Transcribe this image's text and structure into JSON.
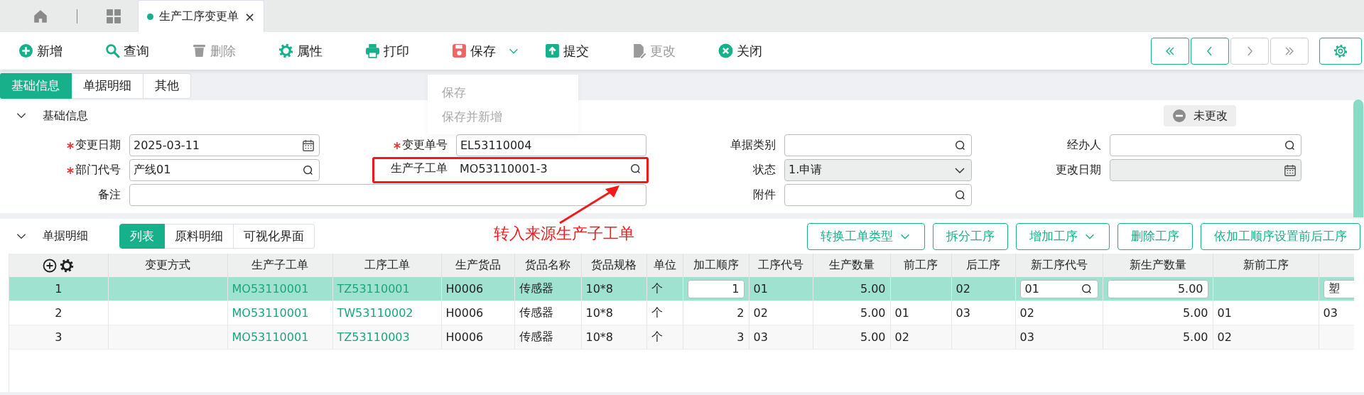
{
  "tab_bar": {
    "tabs": [
      {
        "kind": "home",
        "selected": false
      },
      {
        "kind": "apps",
        "selected": false
      },
      {
        "kind": "page",
        "label": "生产工序变更单",
        "close": "×",
        "selected": true
      }
    ]
  },
  "toolbar": {
    "items": [
      {
        "label": "新增",
        "disabled": false,
        "dropdown": false
      },
      {
        "label": "查询",
        "disabled": false,
        "dropdown": false
      },
      {
        "label": "删除",
        "disabled": true,
        "dropdown": false
      },
      {
        "label": "属性",
        "disabled": false,
        "dropdown": false
      },
      {
        "label": "打印",
        "disabled": false,
        "dropdown": false
      },
      {
        "label": "保存",
        "disabled": false,
        "dropdown": true
      },
      {
        "label": "提交",
        "disabled": false,
        "dropdown": false
      },
      {
        "label": "更改",
        "disabled": true,
        "dropdown": false
      },
      {
        "label": "关闭",
        "disabled": false,
        "dropdown": false
      }
    ],
    "save_menu": [
      {
        "label": "保存"
      },
      {
        "label": "保存并新增"
      }
    ],
    "nav": [
      {
        "disabled": false
      },
      {
        "disabled": false
      },
      {
        "disabled": true
      },
      {
        "disabled": true
      }
    ]
  },
  "page_tabs": [
    {
      "label": "基础信息",
      "selected": true
    },
    {
      "label": "单据明细",
      "selected": false
    },
    {
      "label": "其他",
      "selected": false
    }
  ],
  "basic_info": {
    "title": "基础信息",
    "expanded": true,
    "status_badge": "未更改",
    "fields": [
      {
        "label": "变更日期",
        "required": true,
        "value": "2025-03-11",
        "kind": "date",
        "disabled": false,
        "wide": false,
        "highlighted": false
      },
      {
        "label": "变更单号",
        "required": true,
        "value": "EL53110004",
        "kind": "text",
        "disabled": false,
        "wide": false,
        "highlighted": false
      },
      {
        "label": "单据类别",
        "required": false,
        "kind": "lookup",
        "disabled": false,
        "wide": false,
        "highlighted": false
      },
      {
        "label": "经办人",
        "required": false,
        "kind": "lookup",
        "disabled": false,
        "wide": false,
        "highlighted": false
      },
      {
        "label": "部门代号",
        "required": true,
        "value": "产线01",
        "kind": "lookup",
        "disabled": false,
        "wide": false,
        "highlighted": false
      },
      {
        "label": "生产子工单",
        "required": false,
        "value": "MO53110001-3",
        "kind": "lookup",
        "disabled": false,
        "wide": false,
        "highlighted": true
      },
      {
        "label": "状态",
        "required": false,
        "value": "1.申请",
        "kind": "select",
        "disabled": true,
        "wide": false,
        "highlighted": false
      },
      {
        "label": "更改日期",
        "required": false,
        "kind": "date",
        "disabled": true,
        "wide": false,
        "highlighted": false
      },
      {
        "label": "备注",
        "required": false,
        "kind": "text",
        "disabled": false,
        "wide": true,
        "highlighted": false
      },
      {
        "label": "附件",
        "required": false,
        "kind": "lookup",
        "disabled": false,
        "wide": false,
        "highlighted": false
      }
    ],
    "annotation": {
      "text": "转入来源生产子工单"
    }
  },
  "detail": {
    "title": "单据明细",
    "expanded": true,
    "view_tabs": [
      {
        "label": "列表",
        "selected": true
      },
      {
        "label": "原料明细",
        "selected": false
      },
      {
        "label": "可视化界面",
        "selected": false
      }
    ],
    "actions": [
      {
        "label": "转换工单类型",
        "dropdown": true
      },
      {
        "label": "拆分工序",
        "dropdown": false
      },
      {
        "label": "增加工序",
        "dropdown": true
      },
      {
        "label": "删除工序",
        "dropdown": false
      },
      {
        "label": "依加工顺序设置前后工序",
        "dropdown": false
      }
    ],
    "table": {
      "columns": [
        {
          "kind": "tools",
          "editable": false
        },
        {
          "label": "变更方式",
          "kind": "text",
          "editable": false
        },
        {
          "label": "生产子工单",
          "kind": "link",
          "editable": false
        },
        {
          "label": "工序工单",
          "kind": "link",
          "editable": false
        },
        {
          "label": "生产货品",
          "kind": "text",
          "editable": false
        },
        {
          "label": "货品名称",
          "kind": "text",
          "editable": false
        },
        {
          "label": "货品规格",
          "kind": "text",
          "editable": false
        },
        {
          "label": "单位",
          "kind": "text",
          "editable": false
        },
        {
          "label": "加工顺序",
          "kind": "number",
          "editable": true
        },
        {
          "label": "工序代号",
          "kind": "text",
          "editable": false
        },
        {
          "label": "生产数量",
          "kind": "number",
          "editable": false
        },
        {
          "label": "前工序",
          "kind": "text",
          "editable": false
        },
        {
          "label": "后工序",
          "kind": "text",
          "editable": false
        },
        {
          "label": "新工序代号",
          "kind": "lookup",
          "editable": true
        },
        {
          "label": "新生产数量",
          "kind": "number",
          "editable": true
        },
        {
          "label": "新前工序",
          "kind": "text",
          "editable": false
        },
        {
          "kind": "text",
          "editable": true
        }
      ],
      "rows": [
        {
          "selected": true,
          "cells": [
            "1",
            null,
            "MO53110001",
            "TZ53110001",
            "H0006",
            "传感器",
            "10*8",
            "个",
            "1",
            "01",
            "5.00",
            null,
            "02",
            "01",
            "5.00",
            null,
            "塑"
          ]
        },
        {
          "selected": false,
          "cells": [
            "2",
            null,
            "MO53110001",
            "TW53110002",
            "H0006",
            "传感器",
            "10*8",
            "个",
            "2",
            "02",
            "5.00",
            "01",
            "03",
            "02",
            "5.00",
            "01",
            "03"
          ]
        },
        {
          "selected": false,
          "cells": [
            "3",
            null,
            "MO53110001",
            "TZ53110003",
            "H0006",
            "传感器",
            "10*8",
            "个",
            "3",
            "03",
            "5.00",
            "02",
            null,
            "03",
            "5.00",
            "02",
            null
          ]
        }
      ]
    }
  }
}
